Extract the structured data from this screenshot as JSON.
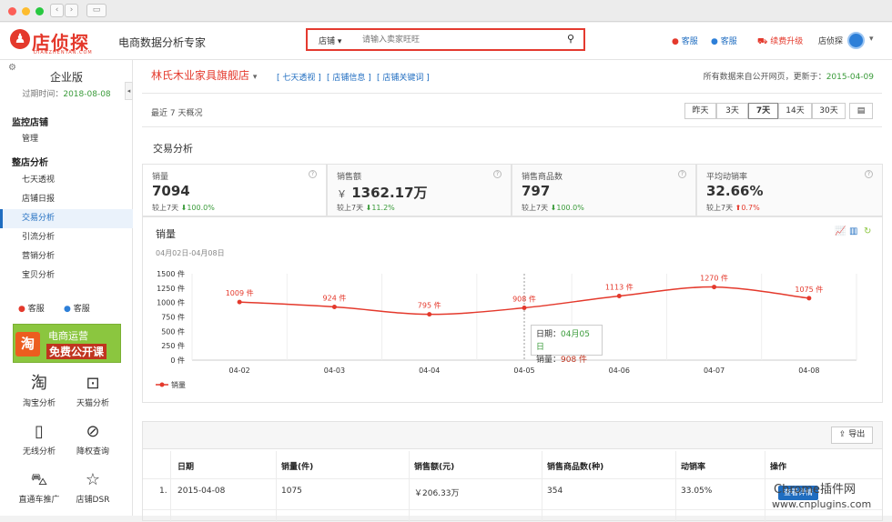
{
  "header": {
    "logo_text": "店侦探",
    "logo_sub": "DIANZHENTAN.COM",
    "slogan": "电商数据分析专家",
    "search_category": "店铺",
    "search_placeholder": "请输入卖家旺旺",
    "links": [
      "客服",
      "客服",
      "续费升级",
      "店侦探"
    ]
  },
  "sidebar": {
    "edition": "企业版",
    "expiry_label": "过期时间：",
    "expiry_date": "2018-08-08",
    "sections": [
      {
        "title": "监控店铺",
        "items": [
          "管理"
        ]
      },
      {
        "title": "整店分析",
        "items": [
          "七天透视",
          "店铺日报",
          "交易分析",
          "引流分析",
          "营销分析",
          "宝贝分析"
        ]
      }
    ],
    "active_item": "交易分析",
    "service": [
      "客服",
      "客服"
    ],
    "banner_line1": "电商运营",
    "banner_line2": "免费公开课",
    "banner_icon": "淘",
    "tools": [
      "淘宝分析",
      "天猫分析",
      "无线分析",
      "降权查询",
      "直通车推广",
      "店铺DSR"
    ]
  },
  "main": {
    "shop_name": "林氏木业家具旗舰店",
    "quick_links": [
      "七天透视",
      "店铺信息",
      "店铺关键词"
    ],
    "source_note": "所有数据来自公开网页，更新于：",
    "update_date": "2015-04-09",
    "period_label": "最近 7 天概况",
    "date_buttons": [
      "昨天",
      "3天",
      "7天",
      "14天",
      "30天"
    ],
    "active_range": "7天",
    "section_title": "交易分析",
    "metrics": [
      {
        "label": "销量",
        "value": "7094",
        "compare": "较上7天",
        "change": "100.0%",
        "dir": "up",
        "color": "#3a9b3a"
      },
      {
        "label": "销售额",
        "value": "1362.17万",
        "prefix": "￥",
        "compare": "较上7天",
        "change": "11.2%",
        "dir": "up",
        "color": "#3a9b3a"
      },
      {
        "label": "销售商品数",
        "value": "797",
        "compare": "较上7天",
        "change": "100.0%",
        "dir": "up",
        "color": "#3a9b3a"
      },
      {
        "label": "平均动销率",
        "value": "32.66%",
        "compare": "较上7天",
        "change": "0.7%",
        "dir": "down",
        "color": "#e4392c"
      }
    ],
    "chart_title": "销量",
    "chart_range": "04月02日-04月08日",
    "tooltip": {
      "date_label": "日期：",
      "date": "04月05日",
      "value_label": "销量：",
      "value": "908 件"
    },
    "table": {
      "export_label": "导出",
      "headers": [
        "日期",
        "销量(件)",
        "销售额(元)",
        "销售商品数(种)",
        "动销率",
        "操作"
      ],
      "rows": [
        {
          "idx": "1.",
          "date": "2015-04-08",
          "sales": "1075",
          "amount": "￥206.33万",
          "items": "354",
          "rate": "33.05%",
          "action": "查看详情"
        }
      ]
    }
  },
  "chart_data": {
    "type": "line",
    "title": "销量",
    "categories": [
      "04-02",
      "04-03",
      "04-04",
      "04-05",
      "04-06",
      "04-07",
      "04-08"
    ],
    "series": [
      {
        "name": "销量",
        "values": [
          1009,
          924,
          795,
          908,
          1113,
          1270,
          1075
        ]
      }
    ],
    "value_labels": [
      "1009 件",
      "924 件",
      "795 件",
      "908 件",
      "1113 件",
      "1270 件",
      "1075 件"
    ],
    "y_ticks": [
      "0 件",
      "250 件",
      "500 件",
      "750 件",
      "1000 件",
      "1250 件",
      "1500 件"
    ],
    "ylim": [
      0,
      1500
    ],
    "color": "#e4392c",
    "legend": "bottom-left",
    "grid": "vertical"
  },
  "watermark": {
    "line1": "Chrome插件网",
    "line2": "www.cnplugins.com"
  },
  "colors": {
    "brand": "#e4392c",
    "link": "#1f6dc0"
  }
}
